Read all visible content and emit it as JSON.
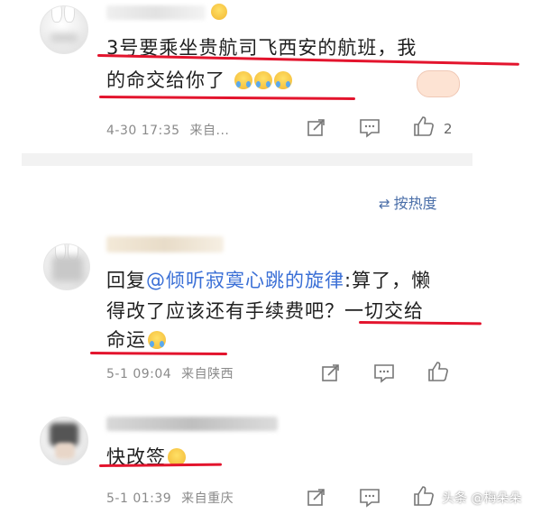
{
  "comments": [
    {
      "text": "3号要乘坐贵航司飞西安的航班，我",
      "text2": "的命交给你了",
      "time": "4-30 17:35",
      "location": "来自...",
      "likes": "2"
    },
    {
      "reply_prefix": "回复",
      "mention": "@倾听寂寞心跳的旋律",
      "text": ":算了，懒",
      "text2": "得改了应该还有手续费吧？一切交给",
      "text3": "命运",
      "time": "5-1 09:04",
      "location": "来自陕西"
    },
    {
      "text": "快改签",
      "time": "5-1 01:39",
      "location": "来自重庆"
    }
  ],
  "sort": {
    "icon": "sort-icon",
    "label": "按热度"
  },
  "watermark": "头条 @梅朵朵",
  "icons": {
    "share": "share-icon",
    "comment": "comment-icon",
    "like": "thumbs-up-icon"
  },
  "colors": {
    "highlight_line": "#e3142d",
    "mention": "#3a6fd6"
  }
}
